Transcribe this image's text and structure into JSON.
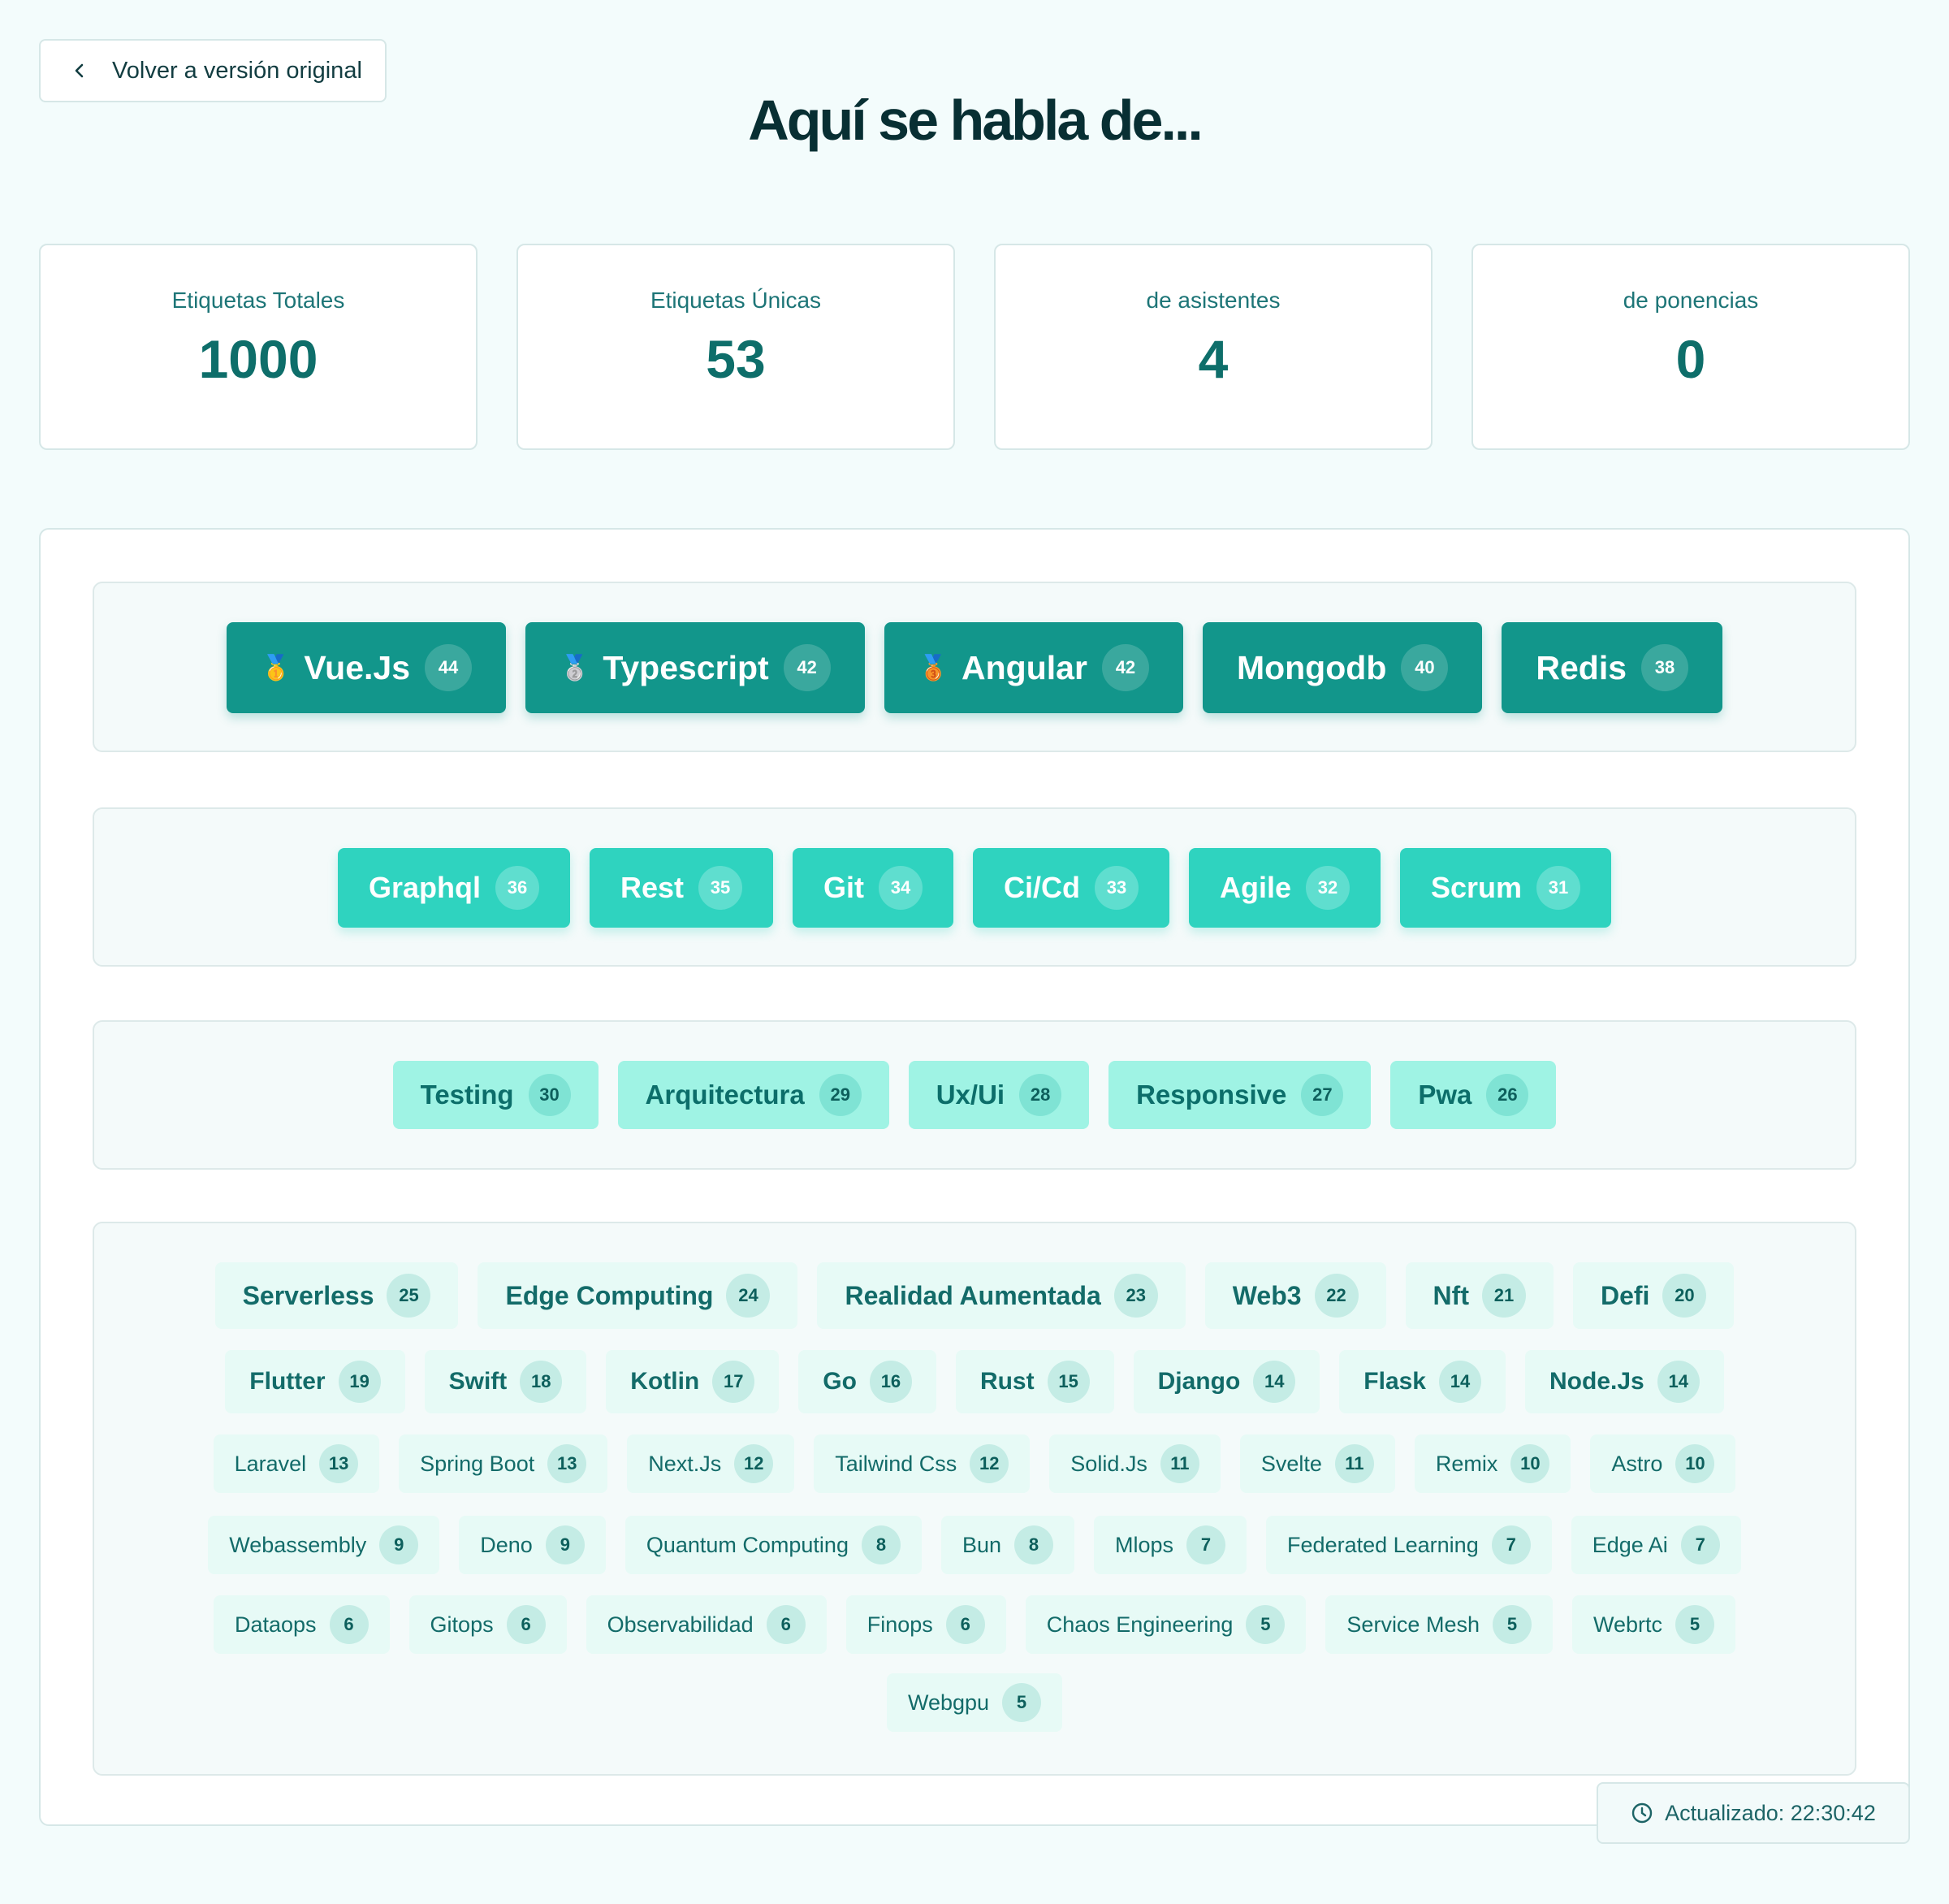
{
  "back_button": {
    "label": "Volver a versión original",
    "icon": "chevron-left-icon"
  },
  "title": "Aquí se habla de...",
  "stats": [
    {
      "label": "Etiquetas Totales",
      "value": "1000"
    },
    {
      "label": "Etiquetas Únicas",
      "value": "53"
    },
    {
      "label": "de asistentes",
      "value": "4"
    },
    {
      "label": "de ponencias",
      "value": "0"
    }
  ],
  "tiers": {
    "top": [
      {
        "name": "Vue.Js",
        "count": "44",
        "medal": "🥇"
      },
      {
        "name": "Typescript",
        "count": "42",
        "medal": "🥈"
      },
      {
        "name": "Angular",
        "count": "42",
        "medal": "🥉"
      },
      {
        "name": "Mongodb",
        "count": "40"
      },
      {
        "name": "Redis",
        "count": "38"
      }
    ],
    "second": [
      {
        "name": "Graphql",
        "count": "36"
      },
      {
        "name": "Rest",
        "count": "35"
      },
      {
        "name": "Git",
        "count": "34"
      },
      {
        "name": "Ci/Cd",
        "count": "33"
      },
      {
        "name": "Agile",
        "count": "32"
      },
      {
        "name": "Scrum",
        "count": "31"
      }
    ],
    "third": [
      {
        "name": "Testing",
        "count": "30"
      },
      {
        "name": "Arquitectura",
        "count": "29"
      },
      {
        "name": "Ux/Ui",
        "count": "28"
      },
      {
        "name": "Responsive",
        "count": "27"
      },
      {
        "name": "Pwa",
        "count": "26"
      }
    ],
    "rest": [
      [
        {
          "name": "Serverless",
          "count": "25"
        },
        {
          "name": "Edge Computing",
          "count": "24"
        },
        {
          "name": "Realidad Aumentada",
          "count": "23"
        },
        {
          "name": "Web3",
          "count": "22"
        },
        {
          "name": "Nft",
          "count": "21"
        },
        {
          "name": "Defi",
          "count": "20"
        }
      ],
      [
        {
          "name": "Flutter",
          "count": "19"
        },
        {
          "name": "Swift",
          "count": "18"
        },
        {
          "name": "Kotlin",
          "count": "17"
        },
        {
          "name": "Go",
          "count": "16"
        },
        {
          "name": "Rust",
          "count": "15"
        },
        {
          "name": "Django",
          "count": "14"
        },
        {
          "name": "Flask",
          "count": "14"
        },
        {
          "name": "Node.Js",
          "count": "14"
        }
      ],
      [
        {
          "name": "Laravel",
          "count": "13"
        },
        {
          "name": "Spring Boot",
          "count": "13"
        },
        {
          "name": "Next.Js",
          "count": "12"
        },
        {
          "name": "Tailwind Css",
          "count": "12"
        },
        {
          "name": "Solid.Js",
          "count": "11"
        },
        {
          "name": "Svelte",
          "count": "11"
        },
        {
          "name": "Remix",
          "count": "10"
        },
        {
          "name": "Astro",
          "count": "10"
        }
      ],
      [
        {
          "name": "Webassembly",
          "count": "9"
        },
        {
          "name": "Deno",
          "count": "9"
        },
        {
          "name": "Quantum Computing",
          "count": "8"
        },
        {
          "name": "Bun",
          "count": "8"
        },
        {
          "name": "Mlops",
          "count": "7"
        },
        {
          "name": "Federated Learning",
          "count": "7"
        },
        {
          "name": "Edge Ai",
          "count": "7"
        }
      ],
      [
        {
          "name": "Dataops",
          "count": "6"
        },
        {
          "name": "Gitops",
          "count": "6"
        },
        {
          "name": "Observabilidad",
          "count": "6"
        },
        {
          "name": "Finops",
          "count": "6"
        },
        {
          "name": "Chaos Engineering",
          "count": "5"
        },
        {
          "name": "Service Mesh",
          "count": "5"
        },
        {
          "name": "Webrtc",
          "count": "5"
        }
      ],
      [
        {
          "name": "Webgpu",
          "count": "5"
        }
      ]
    ]
  },
  "updated": {
    "label": "Actualizado: 22:30:42",
    "icon": "clock-icon"
  }
}
